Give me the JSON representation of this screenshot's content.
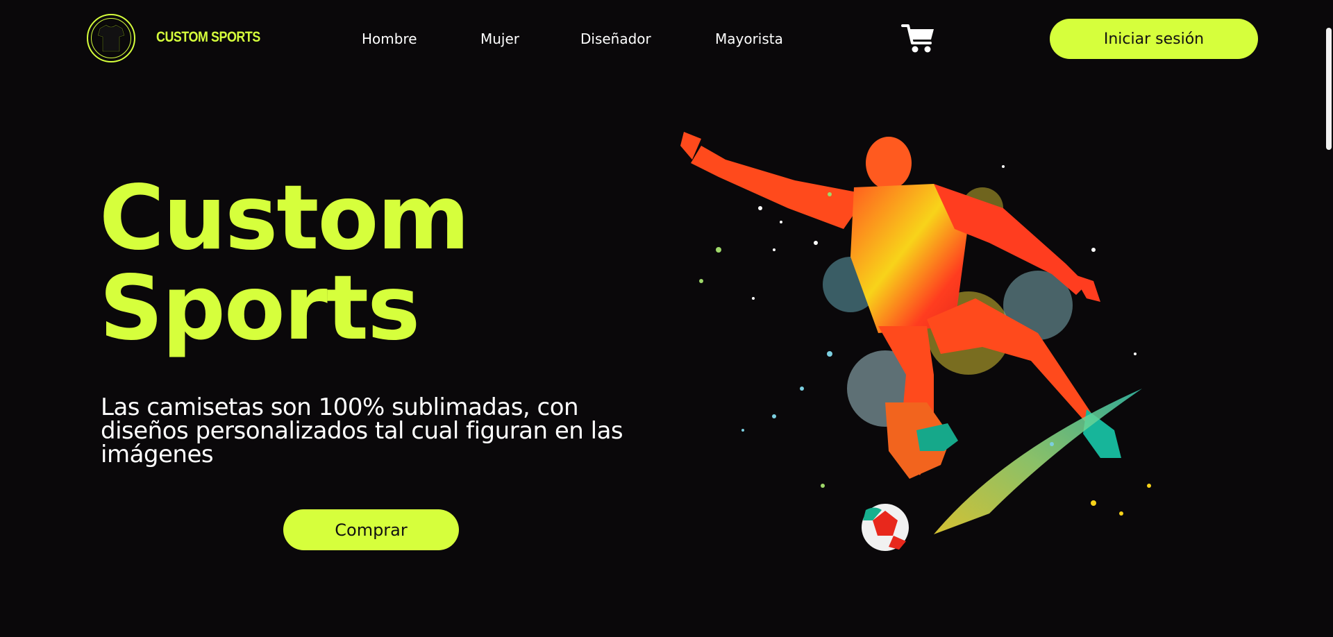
{
  "brand": {
    "name": "CUSTOM SPORTS",
    "logo_icon": "tshirt-icon",
    "accent_color": "#d6ff3c",
    "background_color": "#0a080a"
  },
  "nav": {
    "items": [
      {
        "label": "Hombre"
      },
      {
        "label": "Mujer"
      },
      {
        "label": "Diseñador"
      },
      {
        "label": "Mayorista"
      }
    ],
    "cart_icon": "cart-icon",
    "login_label": "Iniciar sesión"
  },
  "hero": {
    "title_line1": "Custom",
    "title_line2": "Sports",
    "subtitle": "Las camisetas son 100% sublimadas, con diseños personalizados tal cual figuran en las imágenes",
    "cta_label": "Comprar",
    "illustration": "soccer-player-splash-illustration"
  }
}
